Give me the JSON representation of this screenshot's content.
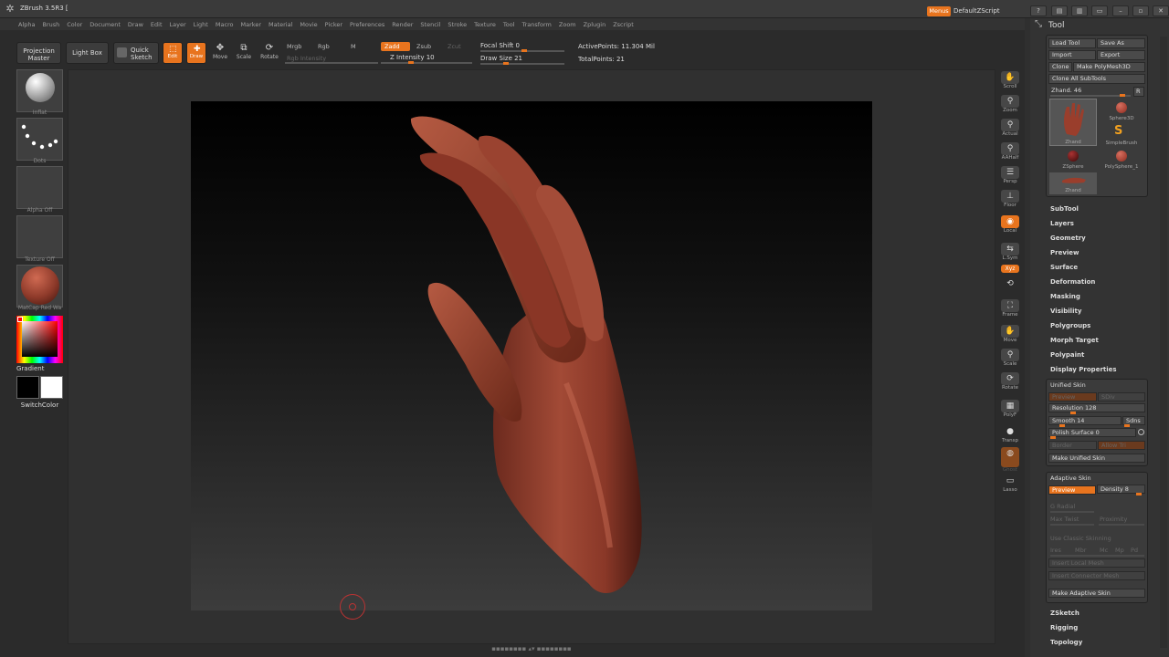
{
  "window": {
    "title": "ZBrush 3.5R3 [",
    "menus_label": "Menus",
    "script_name": "DefaultZScript"
  },
  "menubar": [
    "Alpha",
    "Brush",
    "Color",
    "Document",
    "Draw",
    "Edit",
    "Layer",
    "Light",
    "Macro",
    "Marker",
    "Material",
    "Movie",
    "Picker",
    "Preferences",
    "Render",
    "Stencil",
    "Stroke",
    "Texture",
    "Tool",
    "Transform",
    "Zoom",
    "Zplugin",
    "Zscript"
  ],
  "toolbar": {
    "projection_master": "Projection Master",
    "light_box": "Light Box",
    "quick_sketch": "Quick Sketch",
    "edit": "Edit",
    "draw": "Draw",
    "move": "Move",
    "scale": "Scale",
    "rotate": "Rotate",
    "mrgb": "Mrgb",
    "rgb": "Rgb",
    "m": "M",
    "rgb_intensity": "Rgb Intensity",
    "zadd": "Zadd",
    "zsub": "Zsub",
    "zcut": "Zcut",
    "z_intensity": "Z Intensity 10",
    "focal_shift": "Focal Shift 0",
    "draw_size": "Draw Size 21",
    "active_points": "ActivePoints: 11.304 Mil",
    "total_points": "TotalPoints: 21"
  },
  "left_shelf": {
    "brush": "Inflat",
    "stroke": "Dots",
    "alpha": "Alpha Off",
    "texture": "Texture Off",
    "material": "MatCap Red Wa",
    "gradient": "Gradient",
    "switch_color": "SwitchColor"
  },
  "right_shelf": [
    "Scroll",
    "Zoom",
    "Actual",
    "AAHalf",
    "Persp",
    "Floor",
    "Local",
    "L.Sym",
    "Xyz",
    "",
    "Frame",
    "Move",
    "Scale",
    "Rotate",
    "PolyF",
    "Transp",
    "Ghost",
    "Lasso"
  ],
  "tool_panel": {
    "title": "Tool",
    "load_tool": "Load Tool",
    "save_as": "Save As",
    "import": "Import",
    "export": "Export",
    "clone": "Clone",
    "make_polymesh": "Make PolyMesh3D",
    "clone_all": "Clone All SubTools",
    "current_tool": "Zhand. 46",
    "r_button": "R",
    "thumbs": [
      "Zhand",
      "Sphere3D",
      "SimpleBrush",
      "ZSphere",
      "PolySphere_1",
      "Zhand"
    ],
    "sections_top": [
      "SubTool",
      "Layers",
      "Geometry",
      "Preview",
      "Surface",
      "Deformation",
      "Masking",
      "Visibility",
      "Polygroups",
      "Morph Target",
      "Polypaint",
      "Display Properties"
    ],
    "unified_skin": {
      "title": "Unified Skin",
      "preview": "Preview",
      "sdiv": "SDiv",
      "resolution": "Resolution 128",
      "smooth": "Smooth 14",
      "sdns": "Sdns",
      "polish": "Polish Surface 0",
      "border": "Border",
      "allow_tri": "Allow Tri",
      "make": "Make Unified Skin"
    },
    "adaptive_skin": {
      "title": "Adaptive Skin",
      "preview": "Preview",
      "density": "Density 8",
      "g_radial": "G Radial",
      "max_twist": "Max Twist",
      "proximity": "Proximity",
      "classic": "Use Classic Skinning",
      "ires": "Ires",
      "mbr": "Mbr",
      "mc": "Mc",
      "mp": "Mp",
      "pd": "Pd",
      "insert_local": "Insert Local Mesh",
      "insert_connector": "Insert Connector Mesh",
      "make": "Make Adaptive Skin"
    },
    "sections_bottom": [
      "ZSketch",
      "Rigging",
      "Topology"
    ]
  },
  "colors": {
    "accent": "#e8741e",
    "hand": "#8e3a2a",
    "panel": "#333333"
  }
}
